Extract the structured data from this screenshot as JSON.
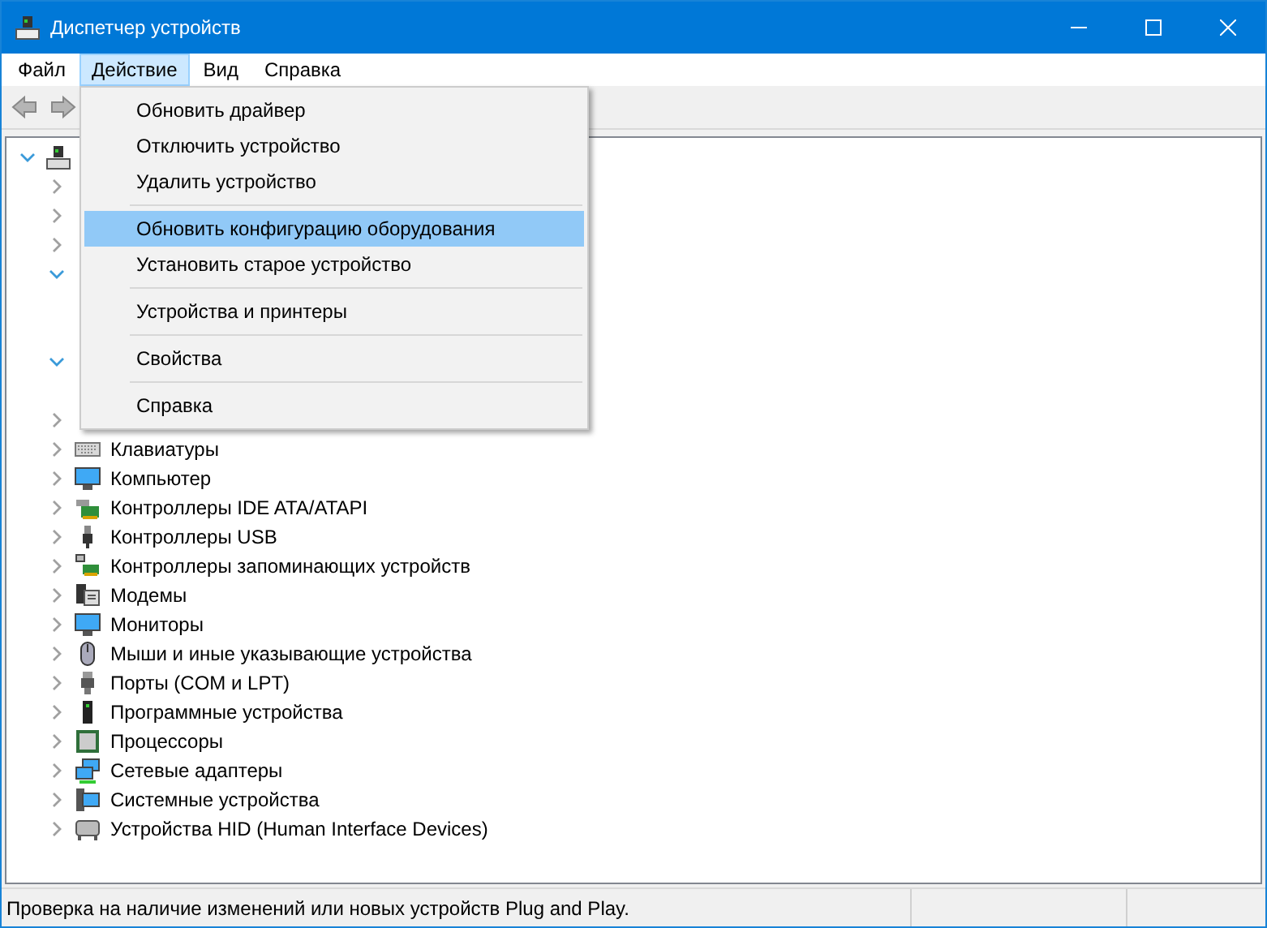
{
  "window": {
    "title": "Диспетчер устройств"
  },
  "menu_bar": [
    {
      "label": "Файл",
      "selected": false
    },
    {
      "label": "Действие",
      "selected": true
    },
    {
      "label": "Вид",
      "selected": false
    },
    {
      "label": "Справка",
      "selected": false
    }
  ],
  "toolbar": [
    {
      "kind": "back",
      "disabled": true
    },
    {
      "kind": "forward",
      "disabled": true
    }
  ],
  "dropdown": [
    {
      "kind": "item",
      "label": "Обновить драйвер",
      "selected": false
    },
    {
      "kind": "item",
      "label": "Отключить устройство",
      "selected": false
    },
    {
      "kind": "item",
      "label": "Удалить устройство",
      "selected": false
    },
    {
      "kind": "separator"
    },
    {
      "kind": "item",
      "label": "Обновить конфигурацию оборудования",
      "selected": true
    },
    {
      "kind": "item",
      "label": "Установить старое устройство",
      "selected": false
    },
    {
      "kind": "separator"
    },
    {
      "kind": "item",
      "label": "Устройства и принтеры",
      "selected": false
    },
    {
      "kind": "separator"
    },
    {
      "kind": "item",
      "label": "Свойства",
      "selected": false
    },
    {
      "kind": "separator"
    },
    {
      "kind": "item",
      "label": "Справка",
      "selected": false
    }
  ],
  "tree": [
    {
      "expanded": true,
      "children": [
        {
          "expanded": false
        },
        {
          "expanded": false
        },
        {
          "expanded": false
        },
        {
          "expanded": true,
          "children": [
            {
              "kind": "device"
            },
            {
              "kind": "device"
            }
          ]
        },
        {
          "expanded": true,
          "children": [
            {
              "kind": "device"
            }
          ]
        },
        {
          "expanded": false
        },
        {
          "label": "Клавиатуры",
          "expanded": false
        },
        {
          "label": "Компьютер",
          "expanded": false
        },
        {
          "label": "Контроллеры IDE ATA/ATAPI",
          "expanded": false
        },
        {
          "label": "Контроллеры USB",
          "expanded": false
        },
        {
          "label": "Контроллеры запоминающих устройств",
          "expanded": false
        },
        {
          "label": "Модемы",
          "expanded": false
        },
        {
          "label": "Мониторы",
          "expanded": false
        },
        {
          "label": "Мыши и иные указывающие устройства",
          "expanded": false
        },
        {
          "label": "Порты (COM и LPT)",
          "expanded": false
        },
        {
          "label": "Программные устройства",
          "expanded": false
        },
        {
          "label": "Процессоры",
          "expanded": false
        },
        {
          "label": "Сетевые адаптеры",
          "expanded": false
        },
        {
          "label": "Системные устройства",
          "expanded": false
        },
        {
          "label": "Устройства HID (Human Interface Devices)",
          "expanded": false
        }
      ]
    }
  ],
  "status_bar": {
    "text": "Проверка на наличие изменений или новых устройств Plug and Play."
  }
}
